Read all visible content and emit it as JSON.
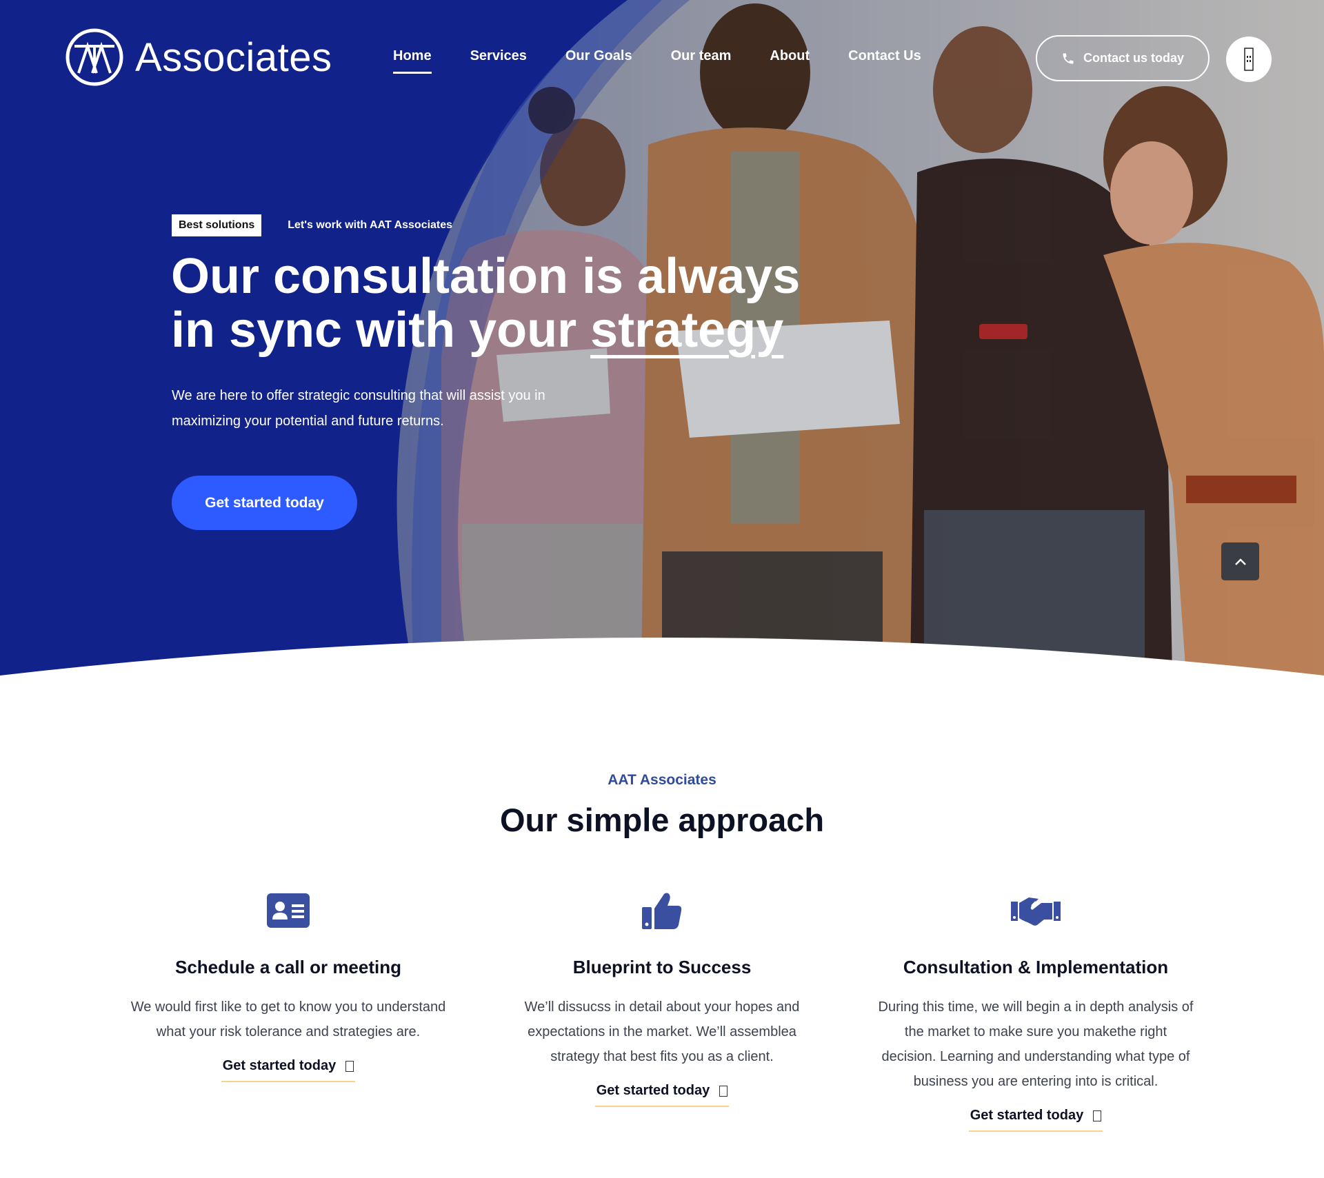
{
  "brand": {
    "name": "Associates"
  },
  "nav": {
    "items": [
      {
        "label": "Home",
        "active": true
      },
      {
        "label": "Services"
      },
      {
        "label": "Our Goals"
      },
      {
        "label": "Our team"
      },
      {
        "label": "About"
      },
      {
        "label": "Contact Us"
      }
    ],
    "contact_button": "Contact us today"
  },
  "hero": {
    "tag": "Best solutions",
    "tag_sub": "Let's work with AAT Associates",
    "title_line1": "Our consultation is always",
    "title_line2_a": "in sync with your ",
    "title_line2_b": "strategy",
    "text": "We are here to offer strategic consulting that will assist you in maximizing your potential and future returns.",
    "cta": "Get started today"
  },
  "approach": {
    "eyebrow": "AAT Associates",
    "title": "Our simple approach",
    "items": [
      {
        "icon": "id-card-icon",
        "title": "Schedule a call or meeting",
        "text": "We would first like to get to know you to understand what your risk tolerance and strategies are.",
        "link": "Get started today"
      },
      {
        "icon": "thumbs-up-icon",
        "title": "Blueprint to Success",
        "text": "We’ll dissucss in detail about your hopes and expectations in the market. We’ll assemblea strategy that best fits you as a client.",
        "link": "Get started today"
      },
      {
        "icon": "handshake-icon",
        "title": "Consultation & Implementation",
        "text": "During this time, we will begin a in depth analysis of the market to make sure you makethe right decision. Learning and understanding what type of business you are entering into is critical.",
        "link": "Get started today"
      }
    ]
  },
  "colors": {
    "hero_blue": "#11228a",
    "cta_blue": "#2e5bff",
    "accent": "#2f4b9a",
    "underline": "#f6d58a"
  }
}
